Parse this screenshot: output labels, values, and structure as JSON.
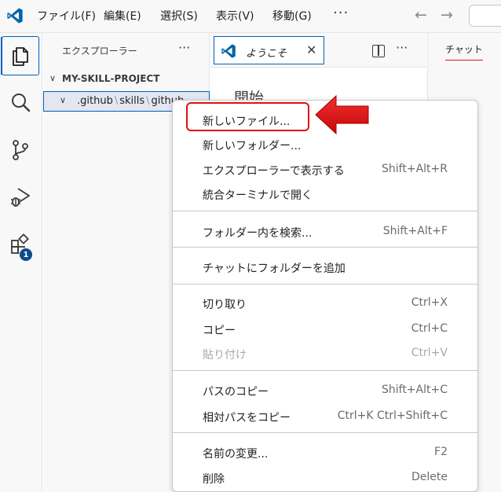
{
  "menubar": {
    "items": [
      "ファイル(F)",
      "編集(E)",
      "選択(S)",
      "表示(V)",
      "移動(G)"
    ],
    "more": "···"
  },
  "activitybar": {
    "icons": [
      "explorer-icon",
      "search-icon",
      "source-control-icon",
      "run-debug-icon",
      "extensions-icon"
    ],
    "extensions_badge": "1"
  },
  "explorer": {
    "title": "エクスプローラー",
    "more": "···",
    "project": "MY-SKILL-PROJECT",
    "folder_path": [
      ".github",
      "skills",
      "github"
    ]
  },
  "editor": {
    "tab_label": "ようこそ",
    "heading": "開始"
  },
  "chat": {
    "tab_label": "チャット"
  },
  "context_menu": {
    "groups": [
      [
        {
          "label": "新しいファイル...",
          "shortcut": "",
          "disabled": false
        },
        {
          "label": "新しいフォルダー...",
          "shortcut": "",
          "disabled": false
        },
        {
          "label": "エクスプローラーで表示する",
          "shortcut": "Shift+Alt+R",
          "disabled": false
        },
        {
          "label": "統合ターミナルで開く",
          "shortcut": "",
          "disabled": false
        }
      ],
      [
        {
          "label": "フォルダー内を検索...",
          "shortcut": "Shift+Alt+F",
          "disabled": false
        }
      ],
      [
        {
          "label": "チャットにフォルダーを追加",
          "shortcut": "",
          "disabled": false
        }
      ],
      [
        {
          "label": "切り取り",
          "shortcut": "Ctrl+X",
          "disabled": false
        },
        {
          "label": "コピー",
          "shortcut": "Ctrl+C",
          "disabled": false
        },
        {
          "label": "貼り付け",
          "shortcut": "Ctrl+V",
          "disabled": true
        }
      ],
      [
        {
          "label": "パスのコピー",
          "shortcut": "Shift+Alt+C",
          "disabled": false
        },
        {
          "label": "相対パスをコピー",
          "shortcut": "Ctrl+K Ctrl+Shift+C",
          "disabled": false
        }
      ],
      [
        {
          "label": "名前の変更...",
          "shortcut": "F2",
          "disabled": false
        },
        {
          "label": "削除",
          "shortcut": "Delete",
          "disabled": false
        }
      ]
    ]
  },
  "colors": {
    "accent": "#005fb8",
    "annotation": "#e01010"
  }
}
